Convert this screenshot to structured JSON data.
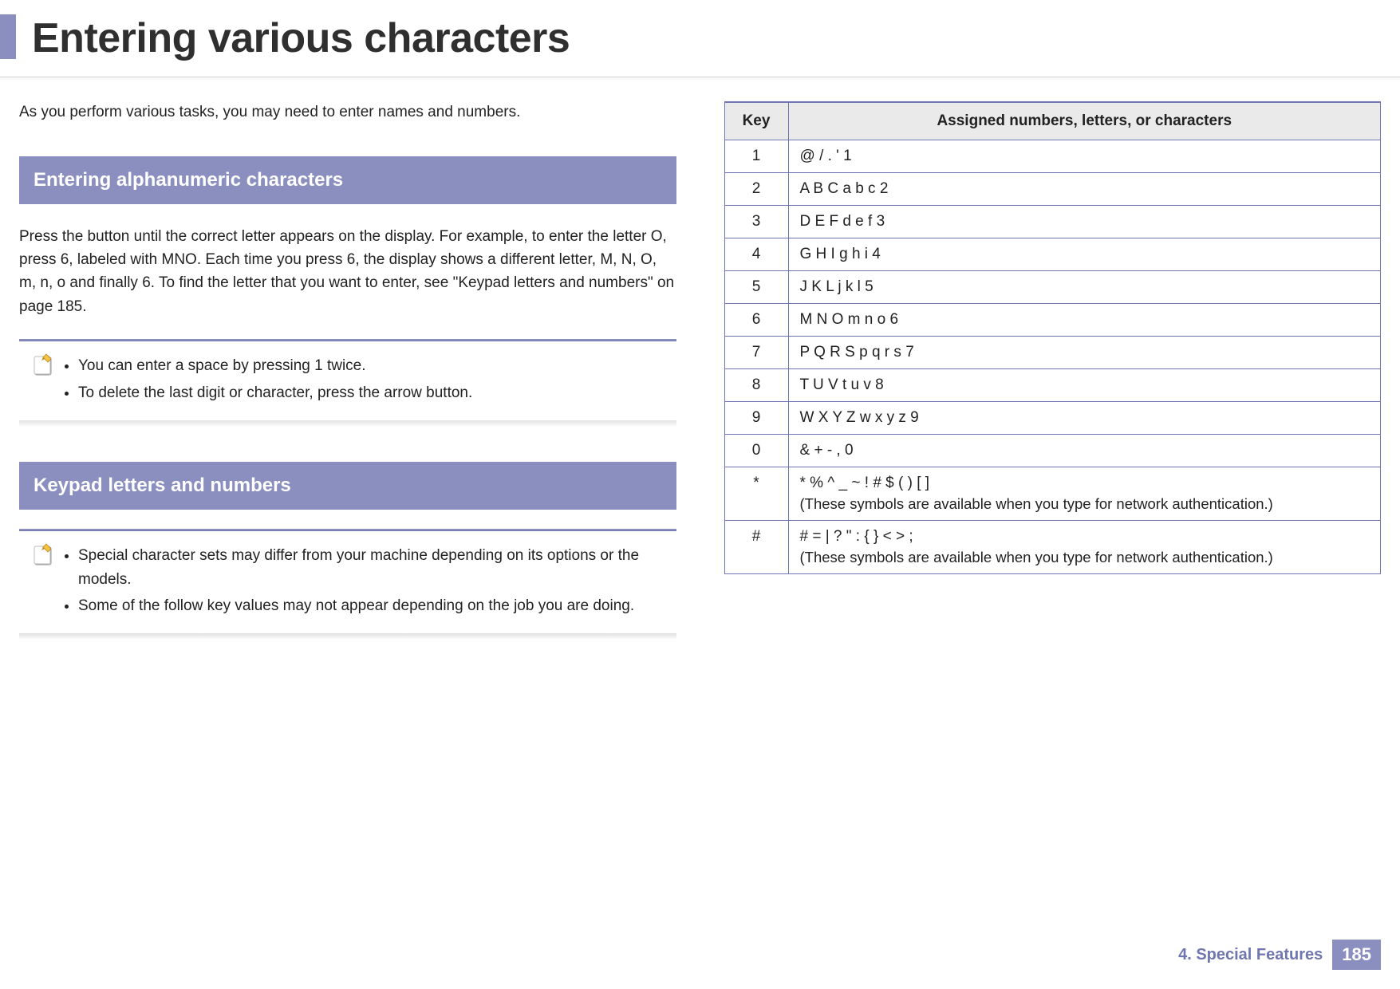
{
  "header": {
    "title": "Entering various characters"
  },
  "intro": "As you perform various tasks, you may need to enter names and numbers.",
  "section1": {
    "heading": "Entering alphanumeric characters",
    "paragraph": "Press the button until the correct letter appears on the display. For example, to enter the letter O, press 6, labeled with MNO. Each time you press 6, the display shows a different letter, M, N, O, m, n, o and finally 6. To find the letter that you want to enter, see \"Keypad letters and numbers\" on page 185."
  },
  "note1": {
    "items": [
      "You can enter a space by pressing 1 twice.",
      "To delete the last digit or character, press the arrow button."
    ]
  },
  "section2": {
    "heading": "Keypad letters and numbers"
  },
  "note2": {
    "items": [
      "Special character sets may differ from your machine depending on its options or the models.",
      "Some of the follow key values may not appear depending on the job you are doing."
    ]
  },
  "table": {
    "header_key": "Key",
    "header_chars": "Assigned numbers, letters, or characters",
    "rows": [
      {
        "key": "1",
        "chars": "@ / . ' 1"
      },
      {
        "key": "2",
        "chars": "A B C a b c 2"
      },
      {
        "key": "3",
        "chars": "D E F d e f 3"
      },
      {
        "key": "4",
        "chars": "G H I g h i 4"
      },
      {
        "key": "5",
        "chars": "J K L j k l 5"
      },
      {
        "key": "6",
        "chars": "M N O m n o 6"
      },
      {
        "key": "7",
        "chars": "P Q R S p q r s 7"
      },
      {
        "key": "8",
        "chars": "T U V t u v 8"
      },
      {
        "key": "9",
        "chars": "W X Y Z w x y z 9"
      },
      {
        "key": "0",
        "chars": "& + - , 0"
      },
      {
        "key": "*",
        "chars": "* % ^ _ ~ ! # $ ( ) [ ]",
        "sub": "(These symbols are available when you type for network authentication.)"
      },
      {
        "key": "#",
        "chars": "# = | ? \" : { } < > ;",
        "sub": "(These symbols are available when you type for network authentication.)"
      }
    ]
  },
  "footer": {
    "chapter": "4.  Special Features",
    "page": "185"
  }
}
